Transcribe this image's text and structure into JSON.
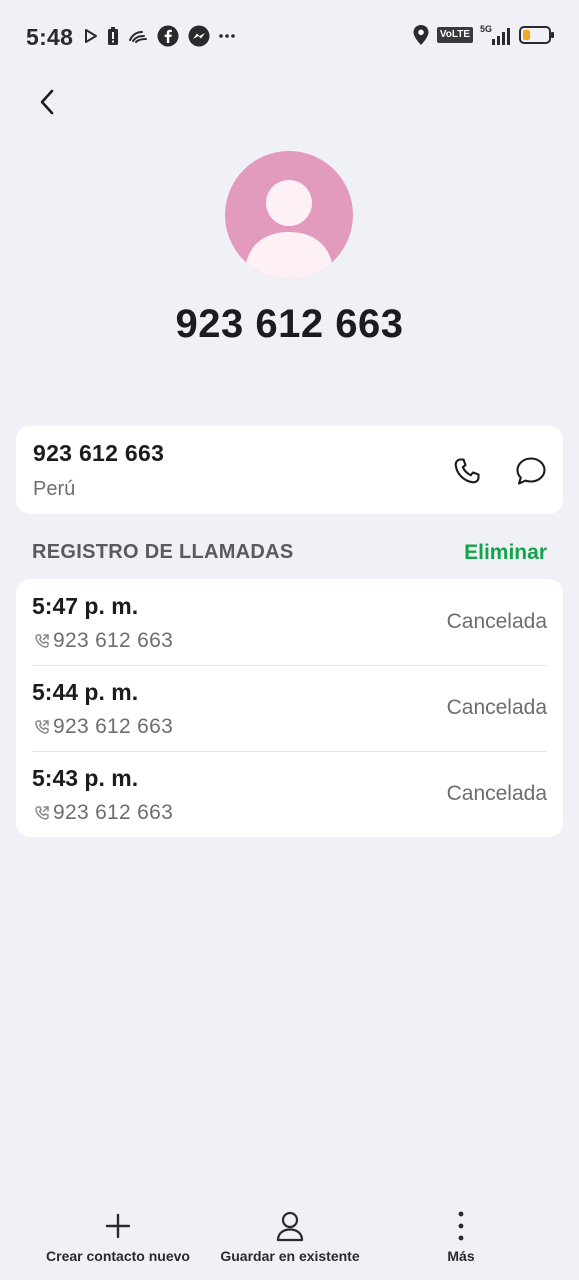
{
  "status_bar": {
    "time": "5:48",
    "left_icons": [
      "play-store-icon",
      "battery-alert-icon",
      "hands-icon",
      "facebook-icon",
      "messenger-icon",
      "more-dots-icon"
    ],
    "volte": "VoLTE",
    "network": "5G",
    "right_icons": [
      "location-icon",
      "volte-badge",
      "signal-5g-icon",
      "battery-icon"
    ]
  },
  "contact": {
    "title": "923 612 663"
  },
  "number_card": {
    "number": "923 612 663",
    "country": "Perú"
  },
  "call_log": {
    "heading": "REGISTRO DE LLAMADAS",
    "delete_label": "Eliminar",
    "entries": [
      {
        "time": "5:47 p. m.",
        "number": "923 612 663",
        "status": "Cancelada"
      },
      {
        "time": "5:44 p. m.",
        "number": "923 612 663",
        "status": "Cancelada"
      },
      {
        "time": "5:43 p. m.",
        "number": "923 612 663",
        "status": "Cancelada"
      }
    ]
  },
  "bottom_bar": {
    "create_label": "Crear contacto nuevo",
    "save_label": "Guardar en existente",
    "more_label": "Más"
  },
  "colors": {
    "background": "#eff1f6",
    "avatar": "#e39bbd",
    "accent_green": "#15a34a",
    "battery_level": "#f5a623"
  }
}
